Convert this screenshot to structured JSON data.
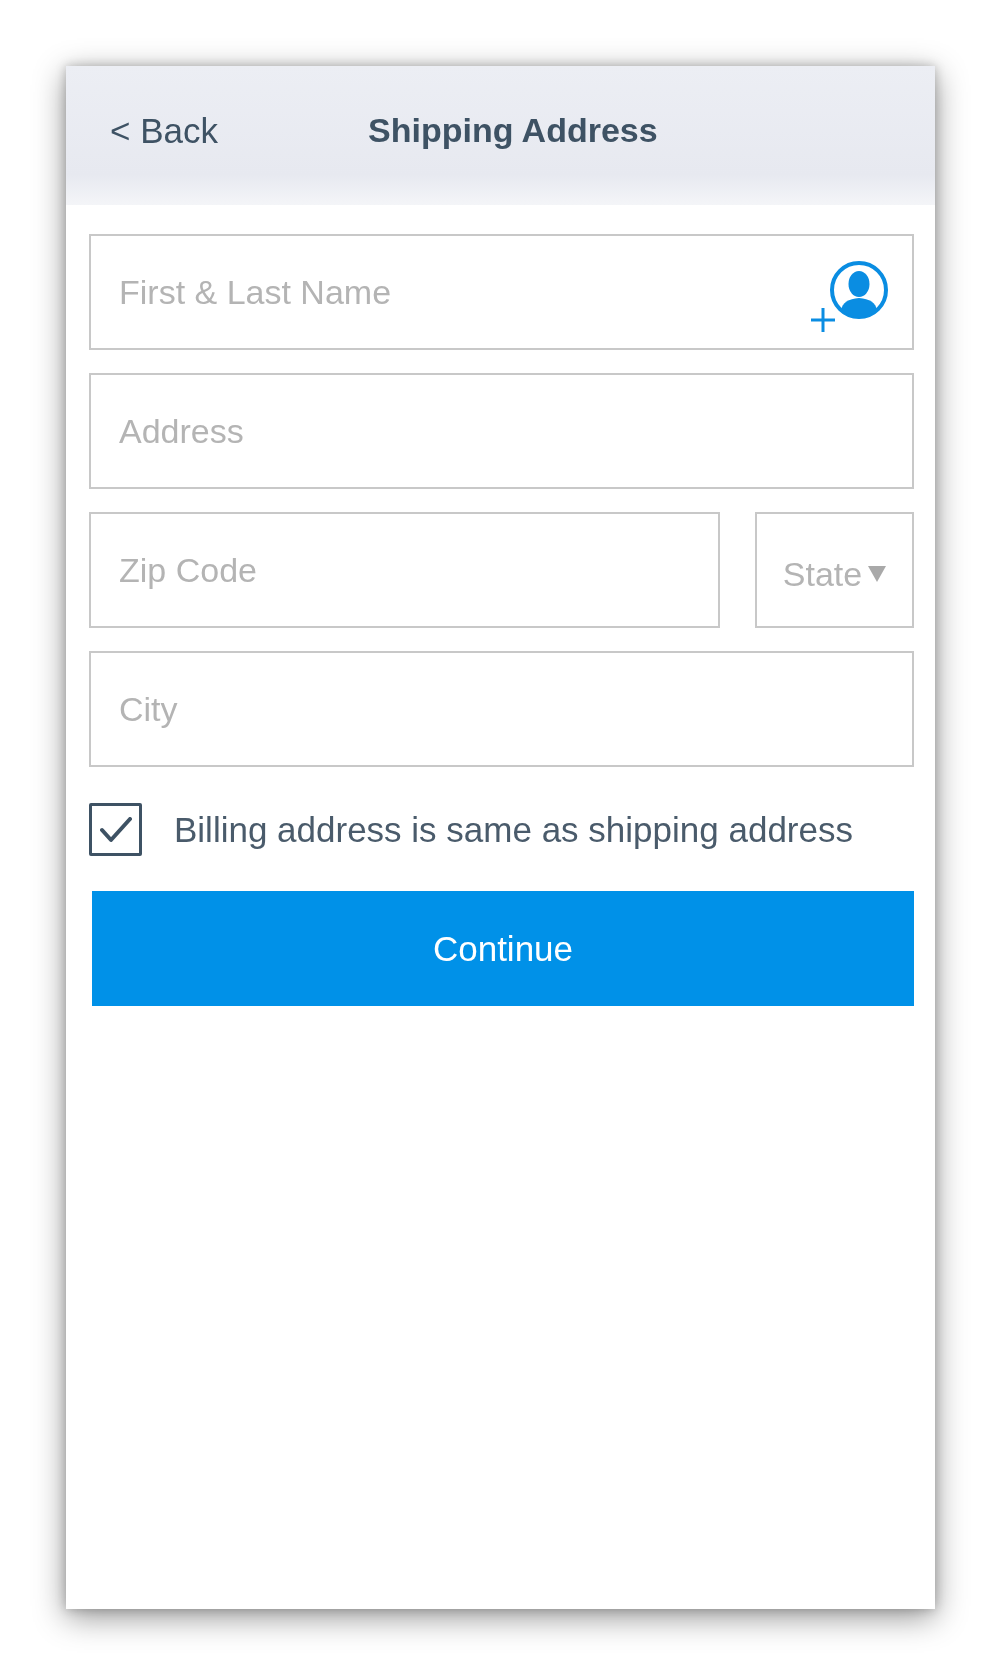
{
  "header": {
    "back": "< Back",
    "title": "Shipping Address"
  },
  "form": {
    "rows": [
      {
        "fields": [
          {
            "kind": "contact",
            "placeholder": "First & Last Name"
          }
        ]
      },
      {
        "fields": [
          {
            "kind": "text",
            "placeholder": "Address"
          }
        ]
      },
      {
        "fields": [
          {
            "kind": "text",
            "placeholder": "Zip Code"
          },
          {
            "kind": "select",
            "placeholder": "State"
          }
        ]
      },
      {
        "fields": [
          {
            "kind": "text",
            "placeholder": "City"
          }
        ]
      }
    ]
  },
  "billing_same": {
    "label": "Billing address is same as shipping address",
    "checked": true
  },
  "continue_button": {
    "label": "Continue"
  }
}
